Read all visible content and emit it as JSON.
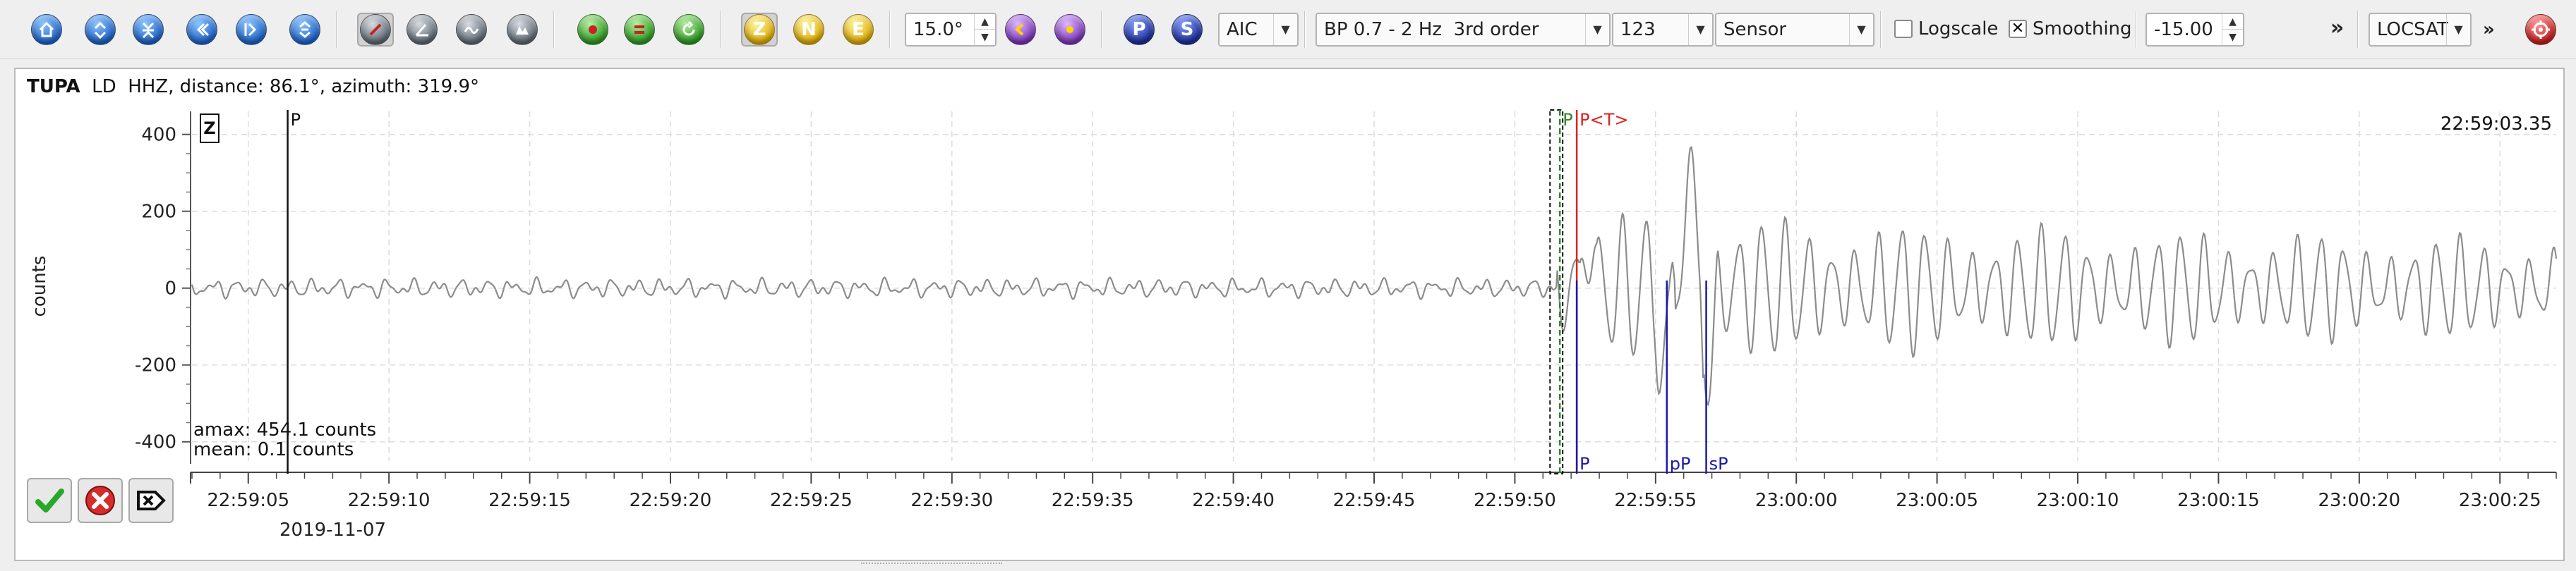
{
  "toolbar": {
    "icons": [
      "home-icon",
      "zoom-in-vertical-icon",
      "zoom-out-vertical-icon",
      "scroll-left-icon",
      "scroll-right-icon",
      "fit-icon",
      "filter-pick-icon",
      "angle-icon",
      "record-icon",
      "spectrum-icon",
      "align-green-icon",
      "reset-green-icon",
      "refresh-green-icon"
    ],
    "components": [
      "Z",
      "N",
      "E"
    ],
    "rotation_value": "15.0°",
    "p_label": "P",
    "s_label": "S",
    "picker_method": "AIC",
    "filter": "BP 0.7 - 2 Hz  3rd order",
    "filter_code": "123",
    "unit_mode": "Sensor",
    "logscale_label": "Logscale",
    "logscale_checked": false,
    "smoothing_label": "Smoothing",
    "smoothing_checked": true,
    "smoothing_value": "-15.00",
    "overflow_chevron": "»",
    "locator": "LOCSAT",
    "locator_chevron": "»",
    "accent_color": "#1f63c8"
  },
  "trace": {
    "station": "TUPA",
    "info": "LD  HHZ, distance: 86.1°, azimuth: 319.9°",
    "component_label": "Z",
    "time_readout": "22:59:03.35",
    "amax": "amax: 454.1 counts",
    "mean": "mean: 0.1 counts",
    "date": "2019-11-07"
  },
  "chart_data": {
    "type": "line",
    "ylabel": "counts",
    "ylim": [
      -450,
      460
    ],
    "yticks": [
      400,
      200,
      0,
      -200,
      -400
    ],
    "x_range_seconds": [
      3.0,
      87.0
    ],
    "x_start_time": "22:59:00",
    "xticks": [
      {
        "t": 5,
        "label": "22:59:05"
      },
      {
        "t": 10,
        "label": "22:59:10"
      },
      {
        "t": 15,
        "label": "22:59:15"
      },
      {
        "t": 20,
        "label": "22:59:20"
      },
      {
        "t": 25,
        "label": "22:59:25"
      },
      {
        "t": 30,
        "label": "22:59:30"
      },
      {
        "t": 35,
        "label": "22:59:35"
      },
      {
        "t": 40,
        "label": "22:59:40"
      },
      {
        "t": 45,
        "label": "22:59:45"
      },
      {
        "t": 50,
        "label": "22:59:50"
      },
      {
        "t": 55,
        "label": "22:59:55"
      },
      {
        "t": 60,
        "label": "23:00:00"
      },
      {
        "t": 65,
        "label": "23:00:05"
      },
      {
        "t": 70,
        "label": "23:00:10"
      },
      {
        "t": 75,
        "label": "23:00:15"
      },
      {
        "t": 80,
        "label": "23:00:20"
      },
      {
        "t": 85,
        "label": "23:00:25"
      }
    ],
    "grid": true,
    "series_color": "#8c8c8c",
    "picks": [
      {
        "label": "P",
        "t": 6.4,
        "color": "#111111",
        "position": "top"
      },
      {
        "label": "P",
        "t": 51.6,
        "color": "#2e8b2e",
        "position": "top"
      },
      {
        "label": "P<T>",
        "t": 52.2,
        "color": "#e02020",
        "position": "top"
      },
      {
        "label": "P",
        "t": 52.2,
        "color": "#1a1aa8",
        "position": "bottom"
      },
      {
        "label": "pP",
        "t": 55.4,
        "color": "#1a1aa8",
        "position": "bottom"
      },
      {
        "label": "sP",
        "t": 56.8,
        "color": "#1a1aa8",
        "position": "bottom"
      }
    ],
    "marker_box_t": [
      51.25,
      51.7
    ]
  },
  "actions": [
    "accept-icon",
    "reject-icon",
    "export-icon"
  ]
}
